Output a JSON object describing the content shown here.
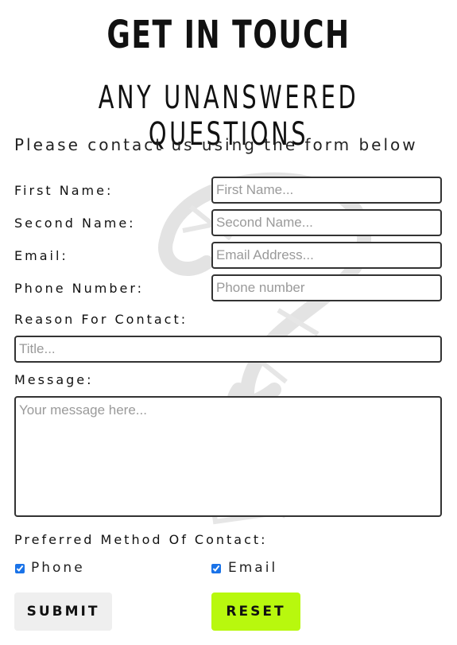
{
  "header": {
    "title": "GET IN TOUCH",
    "subtitle": "ANY UNANSWERED QUESTIONS",
    "intro": "Please contact us using the form below"
  },
  "form": {
    "first_name": {
      "label": "First Name:",
      "placeholder": "First Name..."
    },
    "second_name": {
      "label": "Second Name:",
      "placeholder": "Second Name..."
    },
    "email": {
      "label": "Email:",
      "placeholder": "Email Address..."
    },
    "phone": {
      "label": "Phone Number:",
      "placeholder": "Phone number"
    },
    "reason": {
      "label": "Reason For Contact:",
      "placeholder": "Title..."
    },
    "message": {
      "label": "Message:",
      "placeholder": "Your message here..."
    },
    "preferred": {
      "label": "Preferred Method Of Contact:",
      "options": [
        {
          "label": "Phone",
          "checked": true
        },
        {
          "label": "Email",
          "checked": true
        }
      ]
    }
  },
  "buttons": {
    "submit": "SUBMIT",
    "reset": "RESET"
  },
  "colors": {
    "reset_bg": "#b8f80e",
    "submit_bg": "#efefef",
    "border": "#333333",
    "checkbox": "#1a73e8"
  }
}
